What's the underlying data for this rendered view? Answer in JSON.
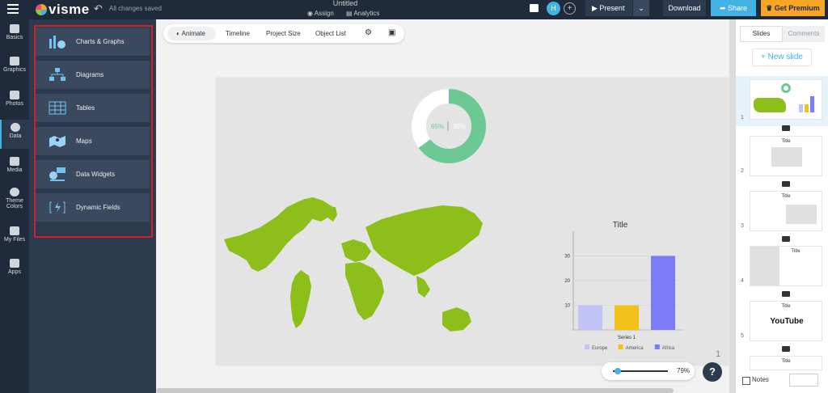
{
  "header": {
    "app_name": "visme",
    "save_status": "All changes saved",
    "doc_title": "Untitled",
    "assign_label": "Assign",
    "analytics_label": "Analytics",
    "avatar_initial": "H",
    "present_label": "Present",
    "download_label": "Download",
    "share_label": "Share",
    "premium_label": "Get Premium"
  },
  "rail": [
    {
      "label": "Basics",
      "icon": "basics-icon"
    },
    {
      "label": "Graphics",
      "icon": "graphics-icon"
    },
    {
      "label": "Photos",
      "icon": "photos-icon"
    },
    {
      "label": "Data",
      "icon": "data-icon",
      "active": true
    },
    {
      "label": "Media",
      "icon": "media-icon"
    },
    {
      "label": "Theme Colors",
      "icon": "theme-colors-icon"
    },
    {
      "label": "My Files",
      "icon": "my-files-icon"
    },
    {
      "label": "Apps",
      "icon": "apps-icon"
    }
  ],
  "panel": {
    "items": [
      {
        "label": "Charts & Graphs",
        "icon": "charts-graphs-icon"
      },
      {
        "label": "Diagrams",
        "icon": "diagrams-icon"
      },
      {
        "label": "Tables",
        "icon": "tables-icon"
      },
      {
        "label": "Maps",
        "icon": "maps-icon"
      },
      {
        "label": "Data Widgets",
        "icon": "data-widgets-icon"
      },
      {
        "label": "Dynamic Fields",
        "icon": "dynamic-fields-icon"
      }
    ]
  },
  "toolbar": {
    "animate": "Animate",
    "timeline": "Timeline",
    "project_size": "Project Size",
    "object_list": "Object List"
  },
  "slide": {
    "donut": {
      "values": [
        65,
        35
      ],
      "labels": [
        "65%",
        "35%"
      ],
      "colors": [
        "#6dc994",
        "#ffffff"
      ]
    },
    "map_color": "#8cbf1a",
    "page_number": "1"
  },
  "chart_data": {
    "type": "bar",
    "title": "Title",
    "categories": [
      "Series 1"
    ],
    "series": [
      {
        "name": "Europe",
        "values": [
          10
        ],
        "color": "#c1c3f7"
      },
      {
        "name": "America",
        "values": [
          10
        ],
        "color": "#f2c21b"
      },
      {
        "name": "Africa",
        "values": [
          30
        ],
        "color": "#7d7cf8"
      }
    ],
    "ylim": [
      0,
      40
    ],
    "yticks": [
      "10",
      "20",
      "30"
    ],
    "legend": "bottom"
  },
  "zoom": {
    "value": "79%",
    "level": 0.79
  },
  "right_panel": {
    "tab_slides": "Slides",
    "tab_comments": "Comments",
    "new_slide": "+ New slide",
    "thumbs": [
      {
        "num": "1",
        "title": ""
      },
      {
        "num": "2",
        "title": "Title"
      },
      {
        "num": "3",
        "title": "Title"
      },
      {
        "num": "4",
        "title": "Title"
      },
      {
        "num": "5",
        "title": "Title",
        "youtube": "YouTube"
      },
      {
        "num": "",
        "title": "Title"
      }
    ],
    "notes": "Notes"
  }
}
